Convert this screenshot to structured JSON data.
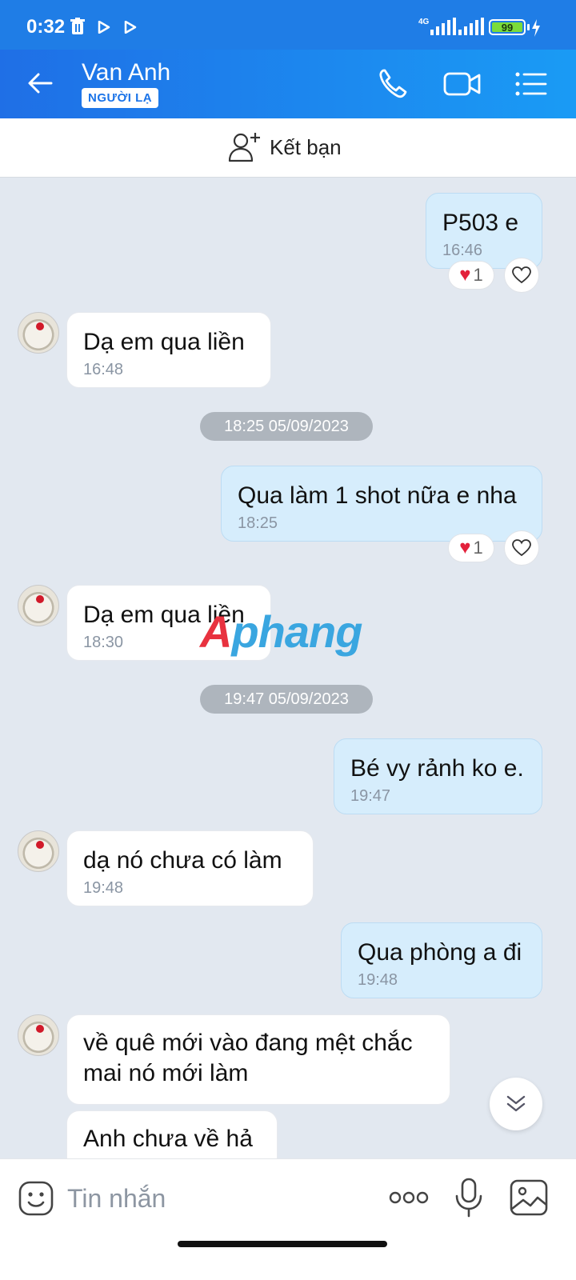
{
  "status_bar": {
    "time": "0:32",
    "network": "4G",
    "battery": "99"
  },
  "header": {
    "contact_name": "Van Anh",
    "badge": "NGƯỜI LẠ"
  },
  "add_friend": {
    "label": "Kết bạn"
  },
  "messages": [
    {
      "direction": "out",
      "text": "P503 e",
      "time": "16:46",
      "reaction_count": "1"
    },
    {
      "direction": "in",
      "text": "Dạ em qua liền",
      "time": "16:48"
    },
    {
      "separator": "18:25 05/09/2023"
    },
    {
      "direction": "out",
      "text": "Qua làm 1 shot nữa e nha",
      "time": "18:25",
      "reaction_count": "1"
    },
    {
      "direction": "in",
      "text": "Dạ em qua liền",
      "time": "18:30"
    },
    {
      "separator": "19:47 05/09/2023"
    },
    {
      "direction": "out",
      "text": "Bé vy rảnh ko e.",
      "time": "19:47"
    },
    {
      "direction": "in",
      "text": "dạ nó chưa có làm",
      "time": "19:48"
    },
    {
      "direction": "out",
      "text": "Qua phòng a đi",
      "time": "19:48"
    },
    {
      "direction": "in",
      "text": "về quê mới vào đang mệt chắc mai nó mới làm"
    },
    {
      "direction": "in",
      "text": "Anh chưa về hả"
    }
  ],
  "watermark": {
    "a": "A",
    "rest": "phang"
  },
  "composer": {
    "placeholder": "Tin nhắn"
  },
  "icons": {
    "heart": "heart-icon",
    "back": "arrow-left-icon",
    "call": "phone-icon",
    "video": "video-camera-icon",
    "menu": "list-menu-icon"
  },
  "colors": {
    "header": "#1f7de6",
    "outgoing_bubble": "#d6edfc",
    "incoming_bubble": "#ffffff",
    "chat_bg": "#e2e8f0"
  }
}
